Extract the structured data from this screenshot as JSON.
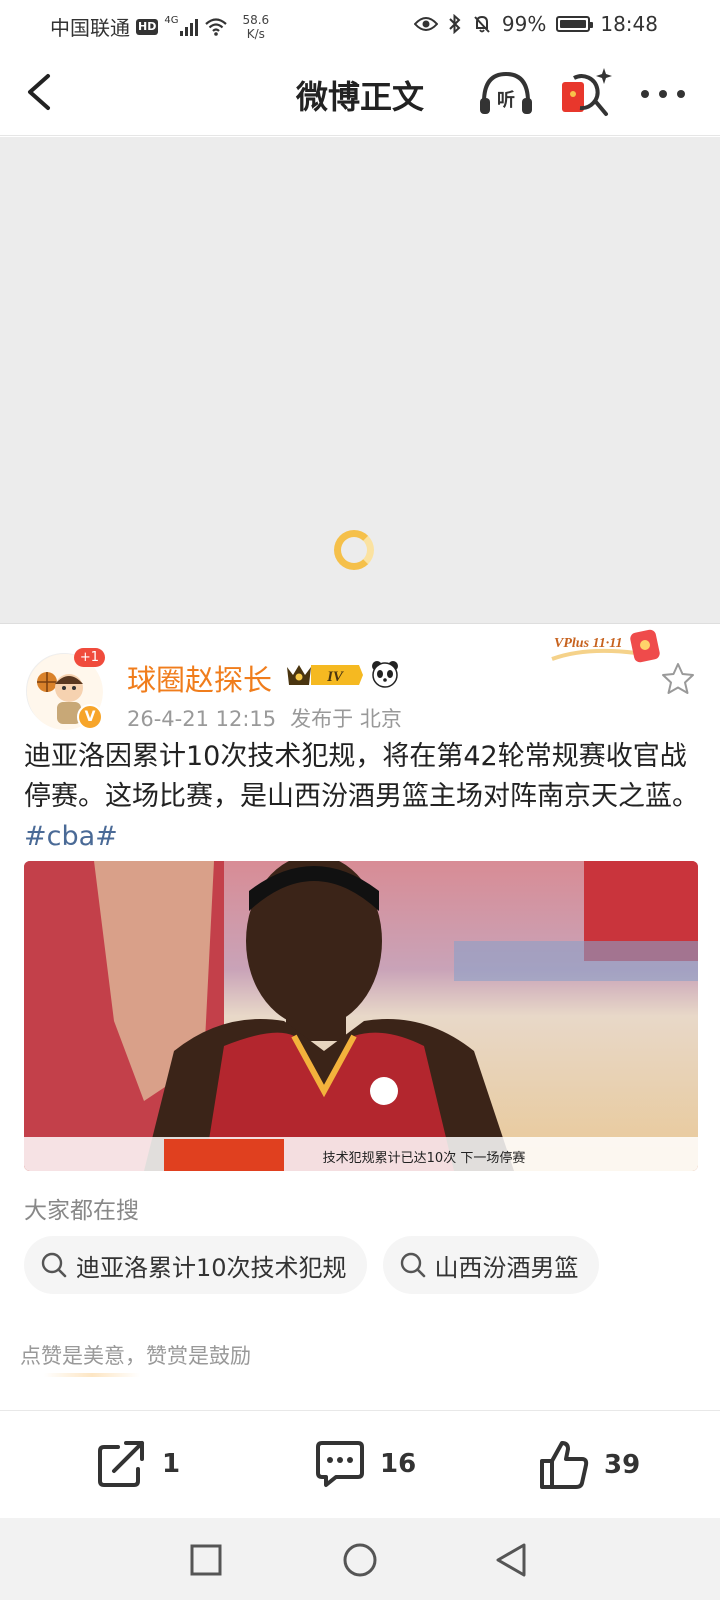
{
  "status_bar": {
    "carrier": "中国联通",
    "hd": "HD",
    "network": "4G",
    "speed_value": "58.6",
    "speed_unit": "K/s",
    "battery": "99%",
    "battery_level": 0.99,
    "time": "18:48"
  },
  "nav": {
    "title": "微博正文",
    "listen_label": "听"
  },
  "post": {
    "author": "球圈赵探长",
    "avatar_badge": "+1",
    "verified_mark": "V",
    "vip_level": "IV",
    "vplus_label": "VPlus 11·11",
    "date": "26-4-21 12:15",
    "location": "发布于 北京",
    "text": "迪亚洛因累计10次技术犯规，将在第42轮常规赛收官战停赛。这场比赛，是山西汾酒男篮主场对阵南京天之蓝。",
    "hashtag": "#cba#",
    "image_caption": "技术犯规累计已达10次 下一场停赛"
  },
  "search": {
    "section_title": "大家都在搜",
    "chips": [
      "迪亚洛累计10次技术犯规",
      "山西汾酒男篮"
    ]
  },
  "reward": {
    "text": "点赞是美意，赞赏是鼓励"
  },
  "actions": {
    "share_count": "1",
    "comment_count": "16",
    "like_count": "39"
  },
  "colors": {
    "username": "#f07d1c",
    "hashtag": "#4a6a96",
    "loading": "#f5c04a"
  }
}
